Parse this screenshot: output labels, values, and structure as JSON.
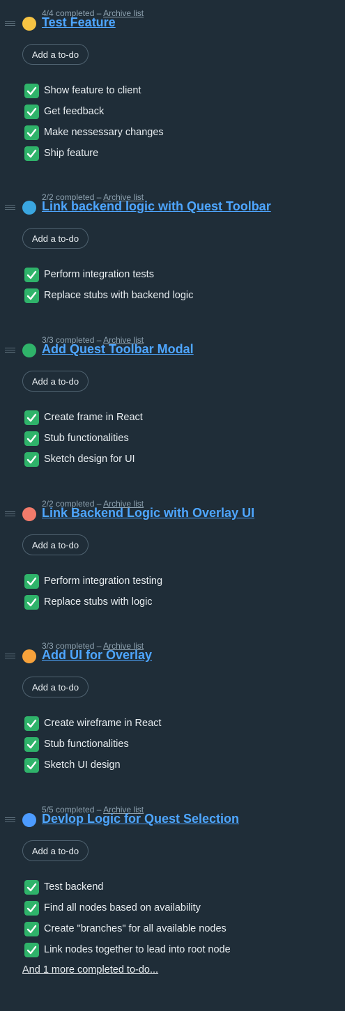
{
  "archive_label": "Archive list",
  "add_label": "Add a to-do",
  "lists": [
    {
      "progress": "4/4 completed –",
      "title": "Test Feature",
      "color": "#f6c343",
      "todos": [
        "Show feature to client",
        "Get feedback",
        "Make nessessary changes",
        "Ship feature"
      ]
    },
    {
      "progress": "2/2 completed –",
      "title": "Link backend logic with Quest Toolbar",
      "color": "#3aa6e0",
      "todos": [
        "Perform integration tests",
        "Replace stubs with backend logic"
      ]
    },
    {
      "progress": "3/3 completed –",
      "title": "Add Quest Toolbar Modal",
      "color": "#2fb36a",
      "todos": [
        "Create frame in React",
        "Stub functionalities",
        "Sketch design for UI"
      ]
    },
    {
      "progress": "2/2 completed –",
      "title": "Link Backend Logic with Overlay UI",
      "color": "#f27b6b",
      "todos": [
        "Perform integration testing",
        "Replace stubs with logic"
      ]
    },
    {
      "progress": "3/3 completed –",
      "title": "Add UI for Overlay",
      "color": "#f7a23b",
      "todos": [
        "Create wireframe in React",
        "Stub functionalities",
        "Sketch UI design"
      ]
    },
    {
      "progress": "5/5 completed –",
      "title": "Devlop Logic for Quest Selection",
      "color": "#4c9bff",
      "todos": [
        "Test backend",
        "Find all nodes based on availability",
        "Create \"branches\" for all available nodes",
        "Link nodes together to lead into root node"
      ],
      "more": "And 1 more completed to-do..."
    }
  ]
}
